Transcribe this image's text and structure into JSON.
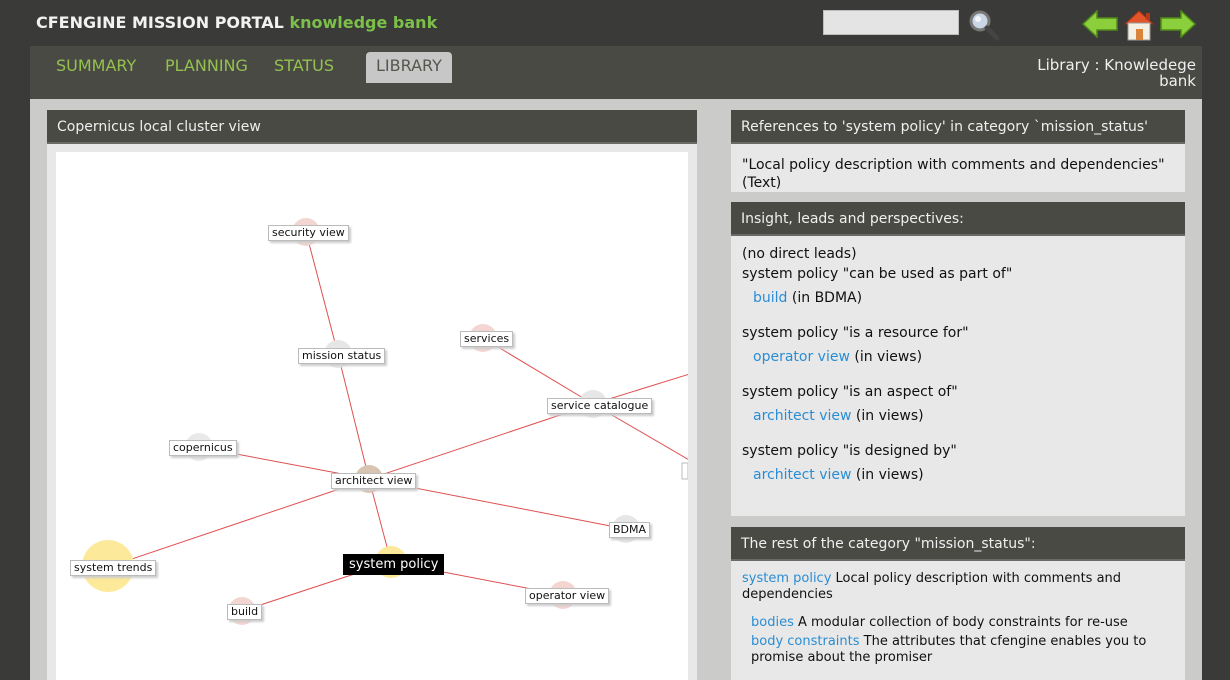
{
  "brand": {
    "title": "CFENGINE MISSION PORTAL",
    "subtitle": "knowledge bank"
  },
  "search": {
    "placeholder": ""
  },
  "tabs": [
    {
      "label": "SUMMARY"
    },
    {
      "label": "PLANNING"
    },
    {
      "label": "STATUS"
    },
    {
      "label": "LIBRARY"
    }
  ],
  "breadcrumb": "Library : Knowledege bank",
  "graph_panel": {
    "title": "Copernicus local cluster view",
    "nodes": {
      "security_view": "security view",
      "mission_status": "mission status",
      "services": "services",
      "service_catalogue": "service catalogue",
      "copernicus": "copernicus",
      "architect_view": "architect view",
      "bdma": "BDMA",
      "system_trends": "system trends",
      "system_policy": "system policy",
      "build": "build",
      "operator_view": "operator view"
    }
  },
  "references": {
    "title": "References to 'system policy' in category `mission_status'",
    "text": "\"Local policy description with comments and dependencies\" (Text)"
  },
  "insight": {
    "title": "Insight, leads and perspectives:",
    "no_leads": "(no direct leads)",
    "sections": [
      {
        "heading": "system policy \"can be used as part of\"",
        "link": "build",
        "suffix": "(in BDMA)"
      },
      {
        "heading": "system policy \"is a resource for\"",
        "link": "operator view",
        "suffix": "(in views)"
      },
      {
        "heading": "system policy \"is an aspect of\"",
        "link": "architect view",
        "suffix": "(in views)"
      },
      {
        "heading": "system policy \"is designed by\"",
        "link": "architect view",
        "suffix": "(in views)"
      }
    ]
  },
  "rest": {
    "title": "The rest of the category \"mission_status\":",
    "main_link": "system policy",
    "main_desc": "Local policy description with comments and dependencies",
    "items": [
      {
        "link": "bodies",
        "desc": "A modular collection of body constraints for re-use"
      },
      {
        "link": "body constraints",
        "desc": "The attributes that cfengine enables you to promise about the promiser"
      }
    ]
  }
}
